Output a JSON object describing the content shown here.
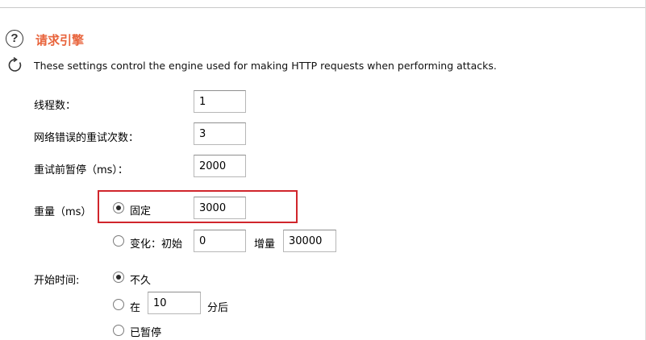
{
  "section": {
    "title": "请求引擎",
    "description": "These settings control the engine used for making HTTP requests when performing attacks."
  },
  "fields": {
    "threads": {
      "label": "线程数：",
      "value": "1"
    },
    "retries": {
      "label": "网络错误的重试次数：",
      "value": "3"
    },
    "pause_before_retry": {
      "label": "重试前暂停（ms）：",
      "value": "2000"
    }
  },
  "throttle": {
    "label": "重量（ms）",
    "fixed": {
      "label": "固定",
      "value": "3000",
      "selected": true
    },
    "variable": {
      "label": "变化：初始",
      "initial_value": "0",
      "step_label": "增量",
      "step_value": "30000",
      "selected": false
    }
  },
  "start_time": {
    "label": "开始时间:",
    "immediately": {
      "label": "不久",
      "selected": true
    },
    "in": {
      "label": "在",
      "value": "10",
      "suffix": "分后",
      "selected": false
    },
    "paused": {
      "label": "已暂停",
      "selected": false
    }
  },
  "colors": {
    "title": "#e8643c",
    "highlight_border": "#d0262c"
  },
  "icons": {
    "help": "help-circle-icon",
    "refresh": "refresh-icon"
  }
}
